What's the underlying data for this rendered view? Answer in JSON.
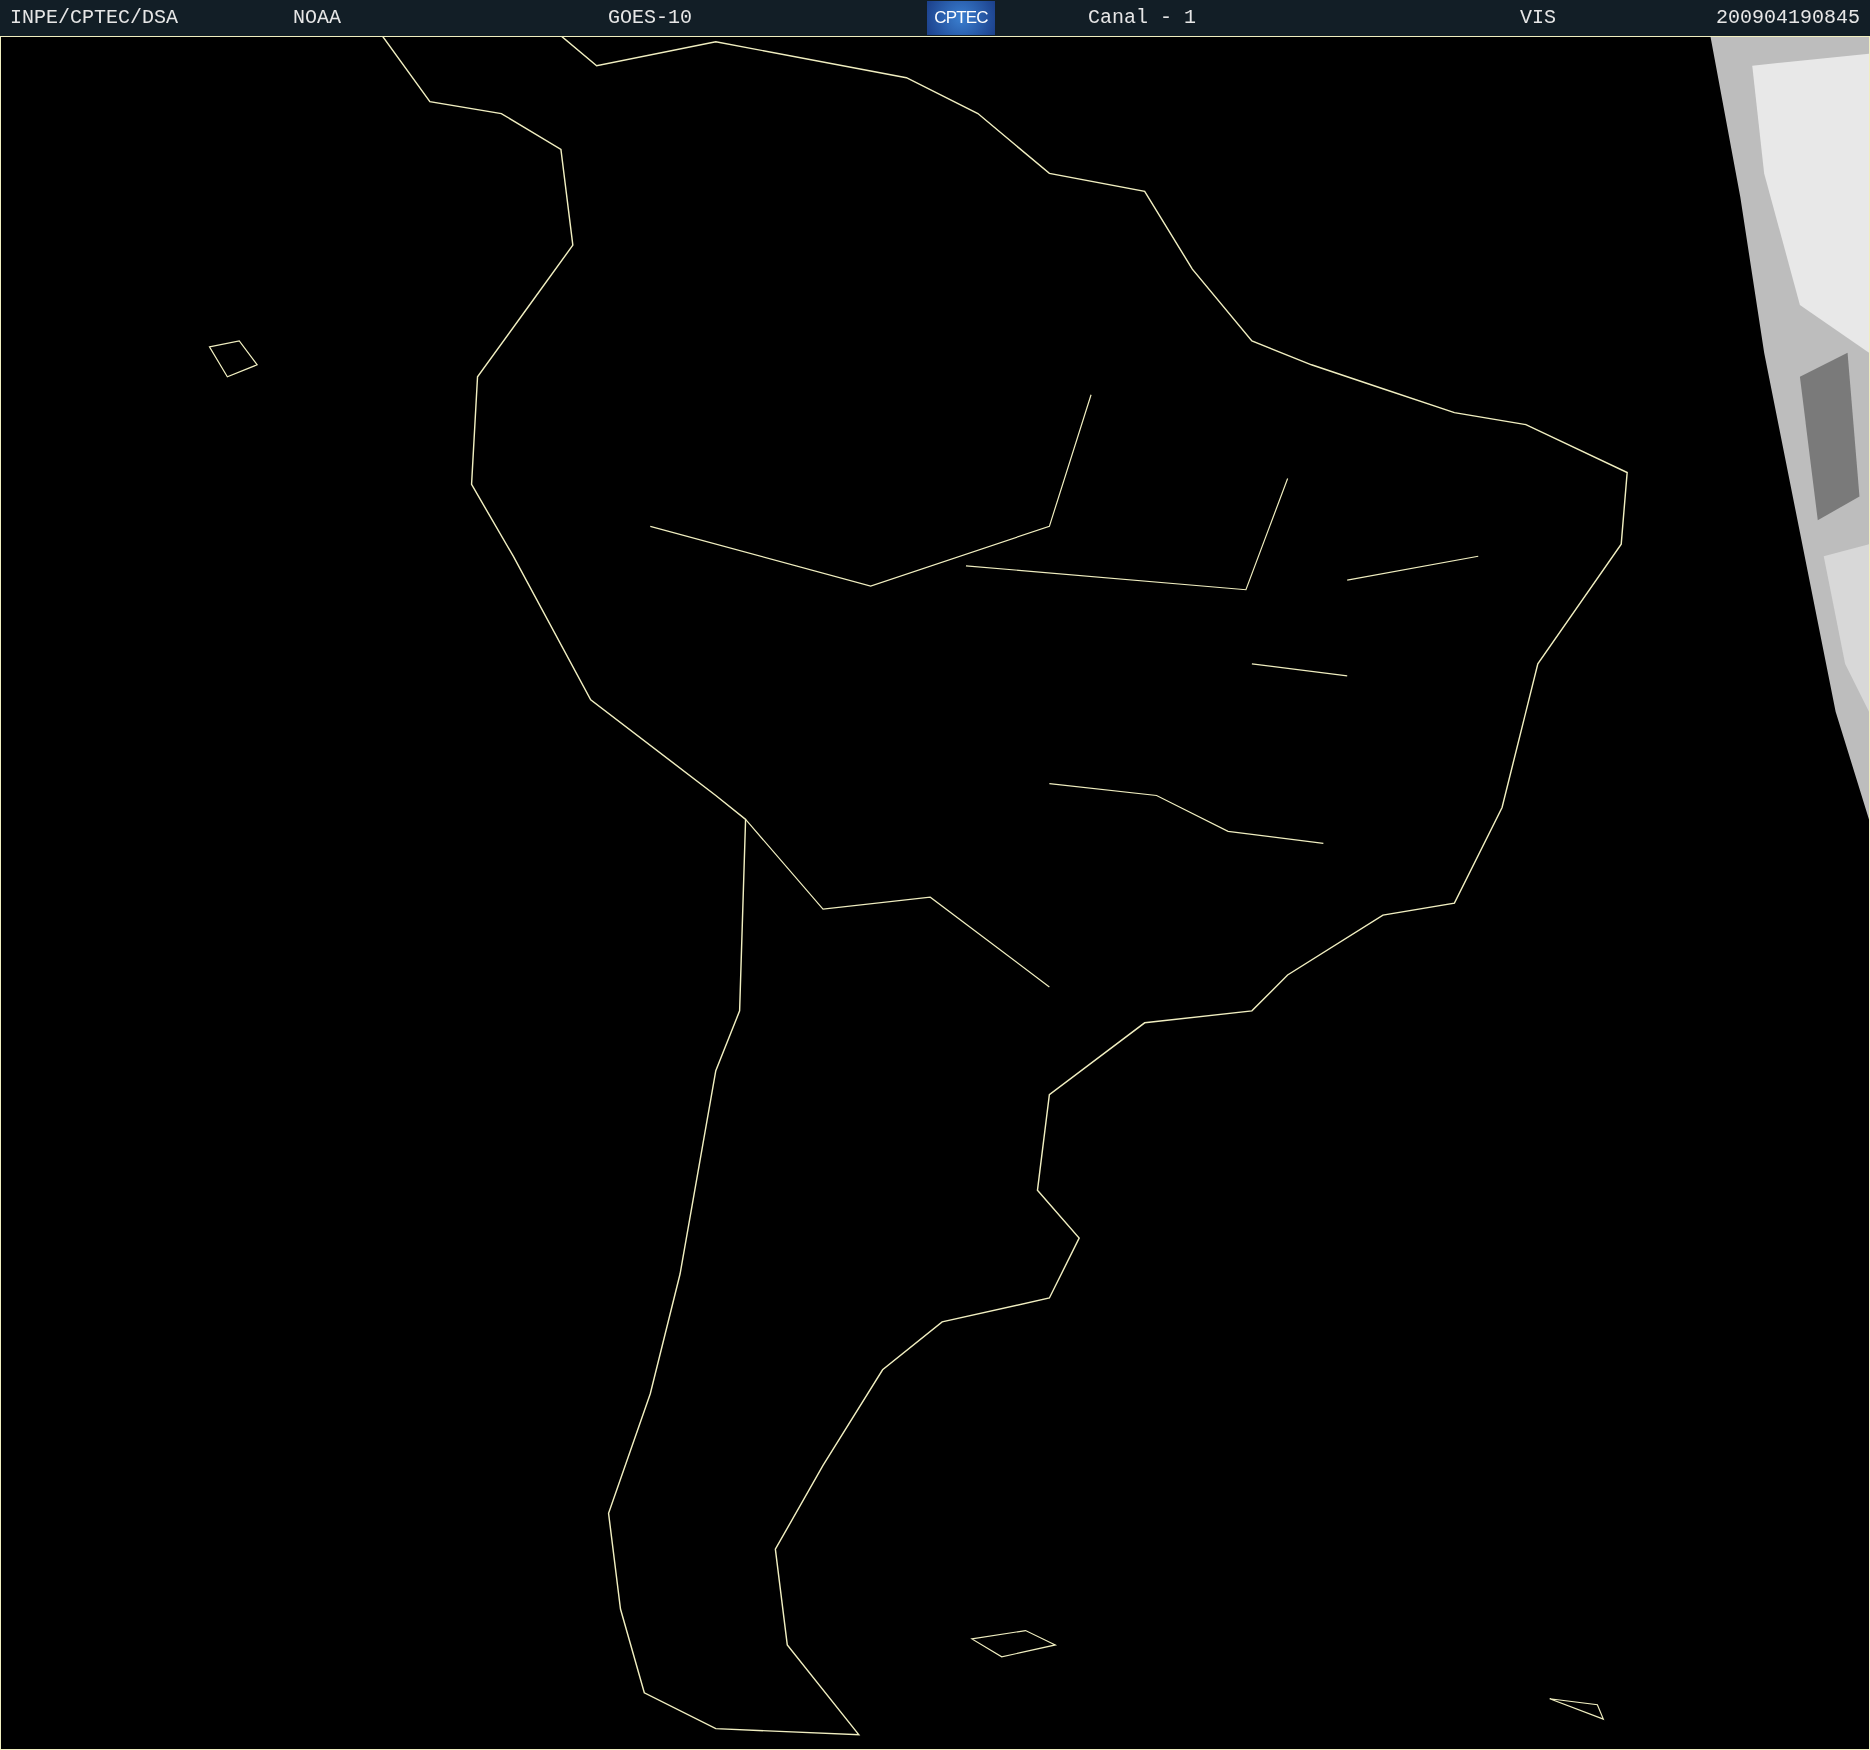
{
  "header": {
    "items": [
      {
        "kind": "text",
        "text": "INPE/CPTEC/DSA"
      },
      {
        "kind": "text",
        "text": "NOAA"
      },
      {
        "kind": "text",
        "text": "GOES-10"
      },
      {
        "kind": "logo",
        "text": "CPTEC"
      },
      {
        "kind": "text",
        "text": "Canal - 1"
      },
      {
        "kind": "text",
        "text": "VIS"
      },
      {
        "kind": "text",
        "text": "200904190845"
      }
    ]
  }
}
